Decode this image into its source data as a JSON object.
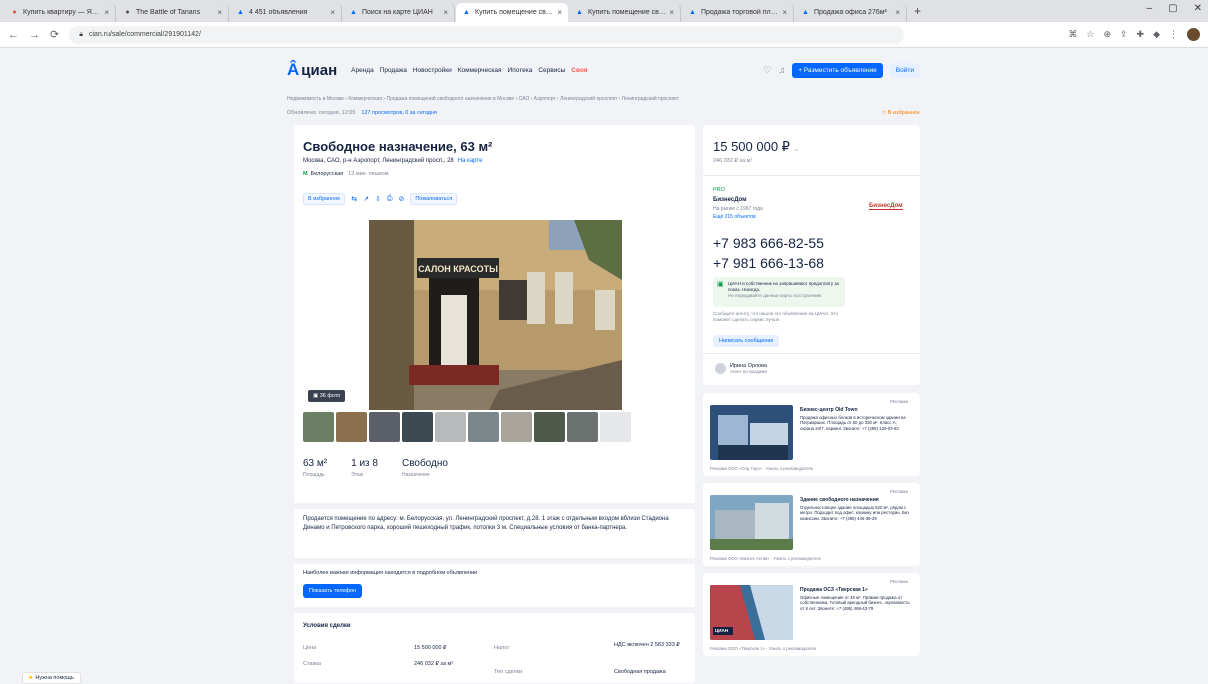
{
  "browser": {
    "tabs": [
      {
        "title": "Купить квартиру — Яндекс",
        "color": "#e8453c",
        "glyph": "●"
      },
      {
        "title": "The Battle of Tanaris",
        "color": "#4a4a4a",
        "glyph": "●"
      },
      {
        "title": "4 451 объявления",
        "color": "#0468ff",
        "glyph": "▲"
      },
      {
        "title": "Поиск на карте ЦИАН",
        "color": "#0468ff",
        "glyph": "▲"
      },
      {
        "title": "Купить помещение свобод",
        "color": "#0468ff",
        "glyph": "▲"
      },
      {
        "title": "Купить помещение свобод",
        "color": "#0468ff",
        "glyph": "▲"
      },
      {
        "title": "Продажа торговой площ",
        "color": "#0468ff",
        "glyph": "▲"
      },
      {
        "title": "Продажа офиса 276м²",
        "color": "#0468ff",
        "glyph": "▲"
      }
    ],
    "active_tab": 4,
    "new_tab": "+",
    "url": "cian.ru/sale/commercial/291901142/",
    "window_controls": [
      "–",
      "▢",
      "✕"
    ]
  },
  "header": {
    "logo": "циан",
    "menu": [
      "Аренда",
      "Продажа",
      "Новостройки",
      "Коммерческая",
      "Ипотека",
      "Сервисы",
      "Своя"
    ],
    "place_button": "+ Разместить объявление",
    "login_button": "Войти"
  },
  "breadcrumbs": "Недвижимость в Москве › Коммерческая › Продажа помещений свободного назначения в Москве › САО › Аэропорт › Ленинградский проспект › Ленинградский проспект",
  "subrow": {
    "views": "Обновлено: сегодня, 12:05",
    "stats": "127 просмотров, 0 за сегодня",
    "favorite": "☆ В избранное"
  },
  "listing": {
    "title": "Свободное назначение, 63 м²",
    "address": "Москва, САО, р-н Аэропорт, Ленинградский просп., 28",
    "map_link": "На карте",
    "metro": "Белорусская",
    "walk": "13 мин. пешком",
    "actions": [
      "В избранное",
      "Пожаловаться"
    ],
    "photo_count": "36 фото",
    "photo_sign": "САЛОН КРАСОТЫ",
    "stats": [
      {
        "value": "63 м²",
        "label": "Площадь"
      },
      {
        "value": "1 из 8",
        "label": "Этаж"
      },
      {
        "value": "Свободно",
        "label": "Назначение"
      }
    ],
    "description": "Продается помещение по адресу: м. Белорусская, ул. Ленинградский проспект, д.28. 1 этаж с отдельным входом вблизи Стадиона Динамо и Петровского парка, хороший пешеходный трафик, потолки 3 м. Специальные условия от банка-партнера.",
    "ask_text": "Наиболее важная информация находится в подробном объявлении",
    "ask_button": "Показать телефон",
    "terms_title": "Условия сделки",
    "terms": [
      {
        "label": "Цена",
        "value": "15 500 000 ₽"
      },
      {
        "label": "Ставка",
        "value": "246 032 ₽ за м²"
      },
      {
        "label": "Налог",
        "value": "НДС включен 2 583 333 ₽"
      },
      {
        "label": "Тип сделки",
        "value": "Свободная продажа"
      }
    ]
  },
  "price_card": {
    "price": "15 500 000 ₽",
    "per_meter": "246 032 ₽ за м²",
    "agent_badge": "PRO",
    "agent_name": "БизнесДом",
    "agent_since": "На рынке с 1997 года",
    "agent_link": "Ещё 215 объектов",
    "agent_logo": "БизнесДом",
    "phones": [
      "+7 983 666-82-55",
      "+7 981 666-13-68"
    ],
    "note": "ЦИАН и собственник не запрашивают предоплату за показ. Никогда.",
    "note_sub": "Не передавайте данные карты посторонним",
    "disclaimer": "Сообщите агенту, что нашли это объявление на ЦИАН. Это поможет сделать сервис лучше.",
    "write_button": "Написать сообщение",
    "author": "Ирина Орлова",
    "author_sub": "Агент по продаже"
  },
  "ads": [
    {
      "label": "Реклама",
      "title": "Бизнес-центр Old Town",
      "text": "Продажа офисных блоков в историческом здании на Патриарших. Площадь от 60 до 330 м². Класс А, охрана 24/7, паркинг. Звоните: +7 (495) 120-03-93",
      "foot": "Реклама ООО «Олд Таун» · Узнать о рекламодателе"
    },
    {
      "label": "Реклама",
      "title": "Здание свободного назначения",
      "text": "Отдельностоящее здание площадью 520 м², рядом с метро. Подходит под офис, клинику или ресторан. Без комиссии. Звоните: +7 (495) 446-38-29",
      "foot": "Реклама ООО «Бизнес Актив» · Узнать о рекламодателе"
    },
    {
      "label": "Реклама",
      "title": "Продажа ОСЗ «Тверская 1»",
      "text": "Офисные помещения от 45 м². Прямая продажа от собственника. Готовый арендный бизнес, окупаемость от 8 лет. Звоните: +7 (495) 468-43-79",
      "foot": "Реклама ООО «Тверская 1» · Узнать о рекламодателе",
      "badge": "ЦИАН"
    }
  ],
  "help_button": "Нужна помощь"
}
